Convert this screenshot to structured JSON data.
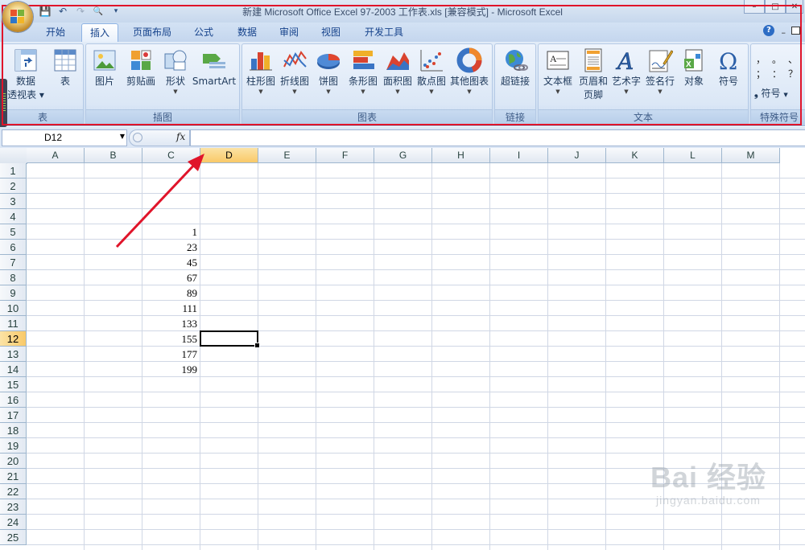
{
  "window": {
    "title": "新建 Microsoft Office Excel 97-2003 工作表.xls  [兼容模式] - Microsoft Excel",
    "controls": [
      "–",
      "□",
      "✕"
    ]
  },
  "quick_access": {
    "save": "💾",
    "undo": "↶",
    "redo": "↷",
    "preview": "🔍",
    "customize": "▾"
  },
  "tabs": [
    "开始",
    "插入",
    "页面布局",
    "公式",
    "数据",
    "审阅",
    "视图",
    "开发工具"
  ],
  "active_tab": "插入",
  "ribbon": {
    "groups": {
      "tables": {
        "label": "表",
        "buttons": {
          "pivot": [
            "数据",
            "透视表"
          ],
          "table": "表"
        }
      },
      "illustrations": {
        "label": "插图",
        "buttons": {
          "picture": "图片",
          "clipart": "剪贴画",
          "shapes": "形状",
          "smartart": "SmartArt"
        }
      },
      "charts": {
        "label": "图表",
        "buttons": {
          "column": "柱形图",
          "line": "折线图",
          "pie": "饼图",
          "bar": "条形图",
          "area": "面积图",
          "scatter": "散点图",
          "other": "其他图表"
        }
      },
      "links": {
        "label": "链接",
        "buttons": {
          "hyperlink": "超链接"
        }
      },
      "text": {
        "label": "文本",
        "buttons": {
          "textbox": "文本框",
          "header_footer": [
            "页眉和",
            "页脚"
          ],
          "wordart": "艺术字",
          "signature": "签名行",
          "object": "对象",
          "symbol": "符号"
        }
      },
      "special": {
        "label": "特殊符号",
        "buttons": {
          "symbol": "符号"
        },
        "marks": [
          "，",
          "。",
          "、",
          "；",
          "：",
          "？"
        ]
      }
    }
  },
  "formula_bar": {
    "name_box": "D12",
    "fx": "fx",
    "formula": ""
  },
  "columns": [
    "A",
    "B",
    "C",
    "D",
    "E",
    "F",
    "G",
    "H",
    "I",
    "J",
    "K",
    "L",
    "M"
  ],
  "selected_column": "D",
  "rows": [
    "1",
    "2",
    "3",
    "4",
    "5",
    "6",
    "7",
    "8",
    "9",
    "10",
    "11",
    "12",
    "13",
    "14",
    "15",
    "16",
    "17",
    "18",
    "19",
    "20",
    "21",
    "22",
    "23",
    "24",
    "25"
  ],
  "selected_row": "12",
  "cells": {
    "C5": "1",
    "C6": "23",
    "C7": "45",
    "C8": "67",
    "C9": "89",
    "C10": "111",
    "C11": "133",
    "C12": "155",
    "C13": "177",
    "C14": "199"
  },
  "watermark": {
    "brand": "Bai 经验",
    "url": "jingyan.baidu.com"
  },
  "colors": {
    "highlight": "#e0142a",
    "selection_header": "#f9c968",
    "ribbon_text": "#1e395b"
  }
}
